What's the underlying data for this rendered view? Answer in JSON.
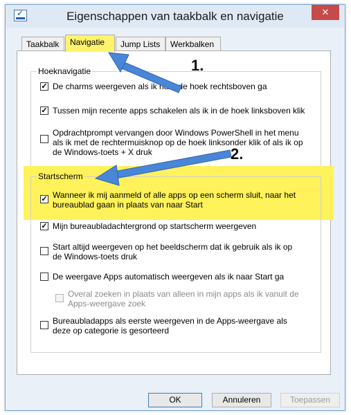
{
  "window": {
    "title": "Eigenschappen van taakbalk en navigatie",
    "close_symbol": "✕",
    "app_icon": "taskbar-properties-icon"
  },
  "tabs": [
    {
      "label": "Taakbalk",
      "active": false
    },
    {
      "label": "Navigatie",
      "active": true,
      "highlighted": true
    },
    {
      "label": "Jump Lists",
      "active": false
    },
    {
      "label": "Werkbalken",
      "active": false
    }
  ],
  "corner_group": {
    "legend": "Hoeknavigatie",
    "options": [
      {
        "line1": "De charms weergeven als ik naar de hoek rechtsboven ga",
        "checked": true,
        "enabled": true
      },
      {
        "line1": "Tussen mijn recente apps schakelen als ik in de hoek linksboven klik",
        "checked": true,
        "enabled": true
      },
      {
        "line1": "Opdrachtprompt vervangen door Windows PowerShell in het menu",
        "line2": "als ik met de rechtermuisknop op de hoek linksonder klik of als ik op",
        "line3": "de Windows-toets + X druk",
        "checked": false,
        "enabled": true
      }
    ]
  },
  "start_group": {
    "legend": "Startscherm",
    "highlight_color": "#fff25a",
    "options": [
      {
        "line1": "Wanneer ik mij aanmeld of alle apps op een scherm sluit, naar het",
        "line2": "bureaublad gaan in plaats van naar Start",
        "checked": true,
        "enabled": true,
        "highlighted": true
      },
      {
        "line1": "Mijn bureaubladachtergrond op startscherm weergeven",
        "checked": true,
        "enabled": true
      },
      {
        "line1": "Start altijd weergeven op het beeldscherm dat ik gebruik als ik op",
        "line2": "de Windows-toets druk",
        "checked": false,
        "enabled": true
      },
      {
        "line1": "De weergave Apps automatisch weergeven als ik naar Start ga",
        "checked": false,
        "enabled": true
      },
      {
        "line1": "Overal zoeken in plaats van alleen in mijn apps als ik vanuit de",
        "line2": "Apps-weergave zoek",
        "checked": false,
        "enabled": false
      },
      {
        "line1": "Bureaubladapps als eerste weergeven in de Apps-weergave als",
        "line2": "deze op categorie is gesorteerd",
        "checked": false,
        "enabled": true
      }
    ]
  },
  "callouts": [
    "1.",
    "2."
  ],
  "buttons": {
    "ok": "OK",
    "cancel": "Annuleren",
    "apply": "Toepassen"
  },
  "colors": {
    "arrow": "#4a86d8",
    "highlight": "#fff25a",
    "close": "#c74a4a"
  }
}
